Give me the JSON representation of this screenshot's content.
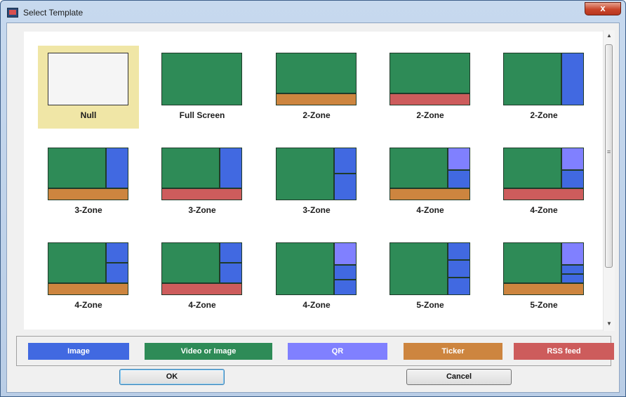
{
  "window": {
    "title": "Select Template",
    "close_glyph": "x"
  },
  "colors": {
    "image": "#4169e1",
    "video_or_image": "#2e8b57",
    "qr": "#8080ff",
    "ticker": "#cd853f",
    "rss_feed": "#cd5c5c"
  },
  "templates": [
    {
      "label": "Null",
      "selected": true
    },
    {
      "label": "Full Screen",
      "selected": false
    },
    {
      "label": "2-Zone",
      "selected": false
    },
    {
      "label": "2-Zone",
      "selected": false
    },
    {
      "label": "2-Zone",
      "selected": false
    },
    {
      "label": "3-Zone",
      "selected": false
    },
    {
      "label": "3-Zone",
      "selected": false
    },
    {
      "label": "3-Zone",
      "selected": false
    },
    {
      "label": "4-Zone",
      "selected": false
    },
    {
      "label": "4-Zone",
      "selected": false
    },
    {
      "label": "4-Zone",
      "selected": false
    },
    {
      "label": "4-Zone",
      "selected": false
    },
    {
      "label": "4-Zone",
      "selected": false
    },
    {
      "label": "5-Zone",
      "selected": false
    },
    {
      "label": "5-Zone",
      "selected": false
    }
  ],
  "legend": [
    {
      "label": "Image",
      "color": "#4169e1"
    },
    {
      "label": "Video or Image",
      "color": "#2e8b57"
    },
    {
      "label": "QR",
      "color": "#8080ff"
    },
    {
      "label": "Ticker",
      "color": "#cd853f"
    },
    {
      "label": "RSS feed",
      "color": "#cd5c5c"
    }
  ],
  "buttons": {
    "ok_label": "OK",
    "cancel_label": "Cancel"
  },
  "scrollbar": {
    "up_glyph": "▲",
    "down_glyph": "▼",
    "grip_glyph": "≡"
  }
}
